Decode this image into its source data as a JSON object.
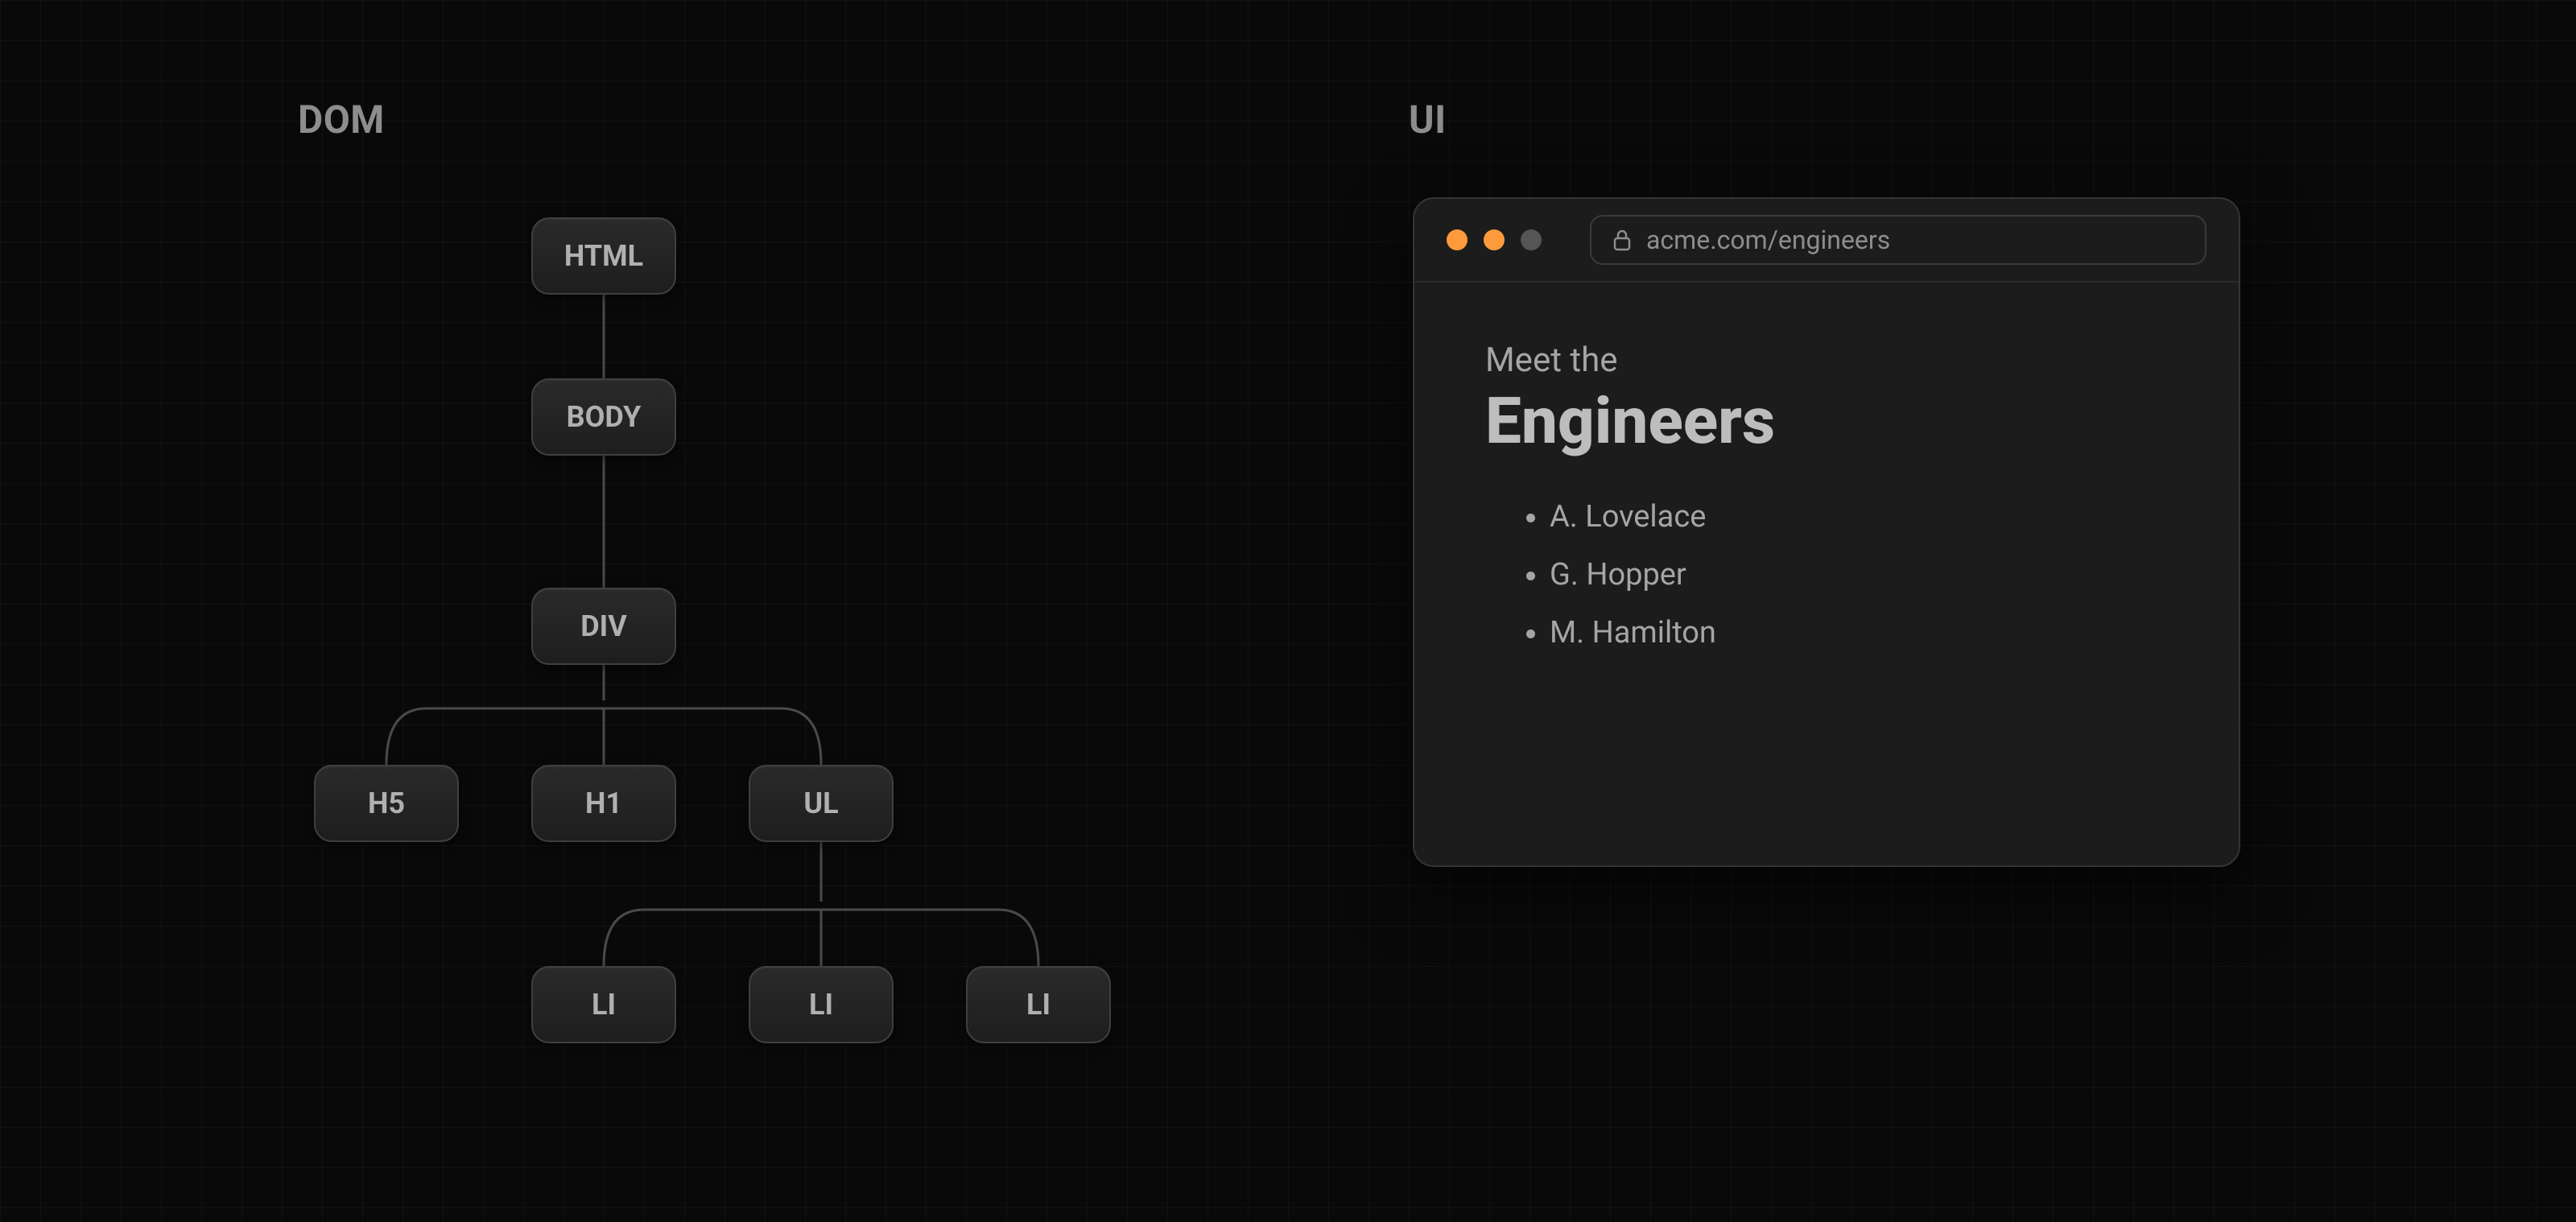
{
  "sections": {
    "dom_label": "DOM",
    "ui_label": "UI"
  },
  "tree": {
    "root": "HTML",
    "body": "BODY",
    "div": "DIV",
    "h5": "H5",
    "h1": "H1",
    "ul": "UL",
    "li1": "LI",
    "li2": "LI",
    "li3": "LI"
  },
  "browser": {
    "url": "acme.com/engineers",
    "traffic_colors": {
      "close": "#ff9a3c",
      "min": "#ff9a3c",
      "max": "#555555"
    },
    "subheading": "Meet the",
    "heading": "Engineers",
    "items": [
      "A. Lovelace",
      "G. Hopper",
      "M. Hamilton"
    ]
  }
}
